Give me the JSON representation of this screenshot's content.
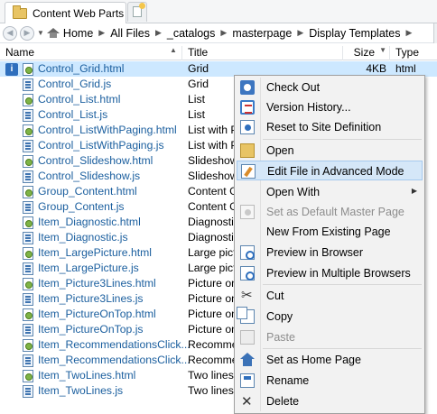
{
  "tab": {
    "label": "Content Web Parts"
  },
  "breadcrumb": [
    "Home",
    "All Files",
    "_catalogs",
    "masterpage",
    "Display Templates"
  ],
  "columns": {
    "name": "Name",
    "title": "Title",
    "size": "Size",
    "type": "Type"
  },
  "files": [
    {
      "name": "Control_Grid.html",
      "title": "Grid",
      "size": "4KB",
      "type": "html",
      "icon": "html"
    },
    {
      "name": "Control_Grid.js",
      "title": "Grid",
      "size": "",
      "type": "",
      "icon": "js"
    },
    {
      "name": "Control_List.html",
      "title": "List",
      "size": "",
      "type": "",
      "icon": "html"
    },
    {
      "name": "Control_List.js",
      "title": "List",
      "size": "",
      "type": "",
      "icon": "js"
    },
    {
      "name": "Control_ListWithPaging.html",
      "title": "List with P",
      "size": "",
      "type": "",
      "icon": "html"
    },
    {
      "name": "Control_ListWithPaging.js",
      "title": "List with P",
      "size": "",
      "type": "",
      "icon": "js"
    },
    {
      "name": "Control_Slideshow.html",
      "title": "Slideshow",
      "size": "",
      "type": "",
      "icon": "html"
    },
    {
      "name": "Control_Slideshow.js",
      "title": "Slideshow",
      "size": "",
      "type": "",
      "icon": "js"
    },
    {
      "name": "Group_Content.html",
      "title": "Content G",
      "size": "",
      "type": "",
      "icon": "html"
    },
    {
      "name": "Group_Content.js",
      "title": "Content G",
      "size": "",
      "type": "",
      "icon": "js"
    },
    {
      "name": "Item_Diagnostic.html",
      "title": "Diagnosti",
      "size": "",
      "type": "",
      "icon": "html"
    },
    {
      "name": "Item_Diagnostic.js",
      "title": "Diagnosti",
      "size": "",
      "type": "",
      "icon": "js"
    },
    {
      "name": "Item_LargePicture.html",
      "title": "Large pict",
      "size": "",
      "type": "",
      "icon": "html"
    },
    {
      "name": "Item_LargePicture.js",
      "title": "Large pict",
      "size": "",
      "type": "",
      "icon": "js"
    },
    {
      "name": "Item_Picture3Lines.html",
      "title": "Picture on",
      "size": "",
      "type": "",
      "icon": "html"
    },
    {
      "name": "Item_Picture3Lines.js",
      "title": "Picture on",
      "size": "",
      "type": "",
      "icon": "js"
    },
    {
      "name": "Item_PictureOnTop.html",
      "title": "Picture on",
      "size": "",
      "type": "",
      "icon": "html"
    },
    {
      "name": "Item_PictureOnTop.js",
      "title": "Picture on",
      "size": "",
      "type": "",
      "icon": "js"
    },
    {
      "name": "Item_RecommendationsClick...",
      "title": "Recommen",
      "size": "",
      "type": "",
      "icon": "html"
    },
    {
      "name": "Item_RecommendationsClick...",
      "title": "Recommen",
      "size": "",
      "type": "",
      "icon": "js"
    },
    {
      "name": "Item_TwoLines.html",
      "title": "Two lines",
      "size": "",
      "type": "",
      "icon": "html"
    },
    {
      "name": "Item_TwoLines.js",
      "title": "Two lines",
      "size": "",
      "type": "",
      "icon": "js"
    }
  ],
  "context_menu": {
    "items": [
      {
        "id": "check-out",
        "label": "Check Out",
        "icon": "checkout-icon",
        "enabled": true
      },
      {
        "id": "version-history",
        "label": "Version History...",
        "icon": "history-icon",
        "enabled": true
      },
      {
        "id": "reset-to-site-definition",
        "label": "Reset to Site Definition",
        "icon": "reset-icon",
        "enabled": true
      },
      {
        "id": "open",
        "label": "Open",
        "icon": "folder-icon",
        "enabled": true
      },
      {
        "id": "edit-advanced",
        "label": "Edit File in Advanced Mode",
        "icon": "edit-icon",
        "enabled": true,
        "highlighted": true
      },
      {
        "id": "open-with",
        "label": "Open With",
        "icon": "",
        "enabled": true,
        "submenu": true
      },
      {
        "id": "set-default-master",
        "label": "Set as Default Master Page",
        "icon": "default-master-icon",
        "enabled": false
      },
      {
        "id": "new-from-existing",
        "label": "New From Existing Page",
        "icon": "",
        "enabled": true
      },
      {
        "id": "preview-browser",
        "label": "Preview in Browser",
        "icon": "preview-icon",
        "enabled": true
      },
      {
        "id": "preview-multiple",
        "label": "Preview in Multiple Browsers",
        "icon": "preview-multiple-icon",
        "enabled": true
      },
      {
        "id": "cut",
        "label": "Cut",
        "icon": "cut-icon",
        "enabled": true
      },
      {
        "id": "copy",
        "label": "Copy",
        "icon": "copy-icon",
        "enabled": true
      },
      {
        "id": "paste",
        "label": "Paste",
        "icon": "paste-icon",
        "enabled": false
      },
      {
        "id": "set-home-page",
        "label": "Set as Home Page",
        "icon": "home-icon",
        "enabled": true
      },
      {
        "id": "rename",
        "label": "Rename",
        "icon": "rename-icon",
        "enabled": true
      },
      {
        "id": "delete",
        "label": "Delete",
        "icon": "delete-icon",
        "enabled": true
      }
    ]
  },
  "colors": {
    "selection": "#cde8ff",
    "menu_highlight": "#d5e7f8",
    "link": "#1a5e9e"
  }
}
